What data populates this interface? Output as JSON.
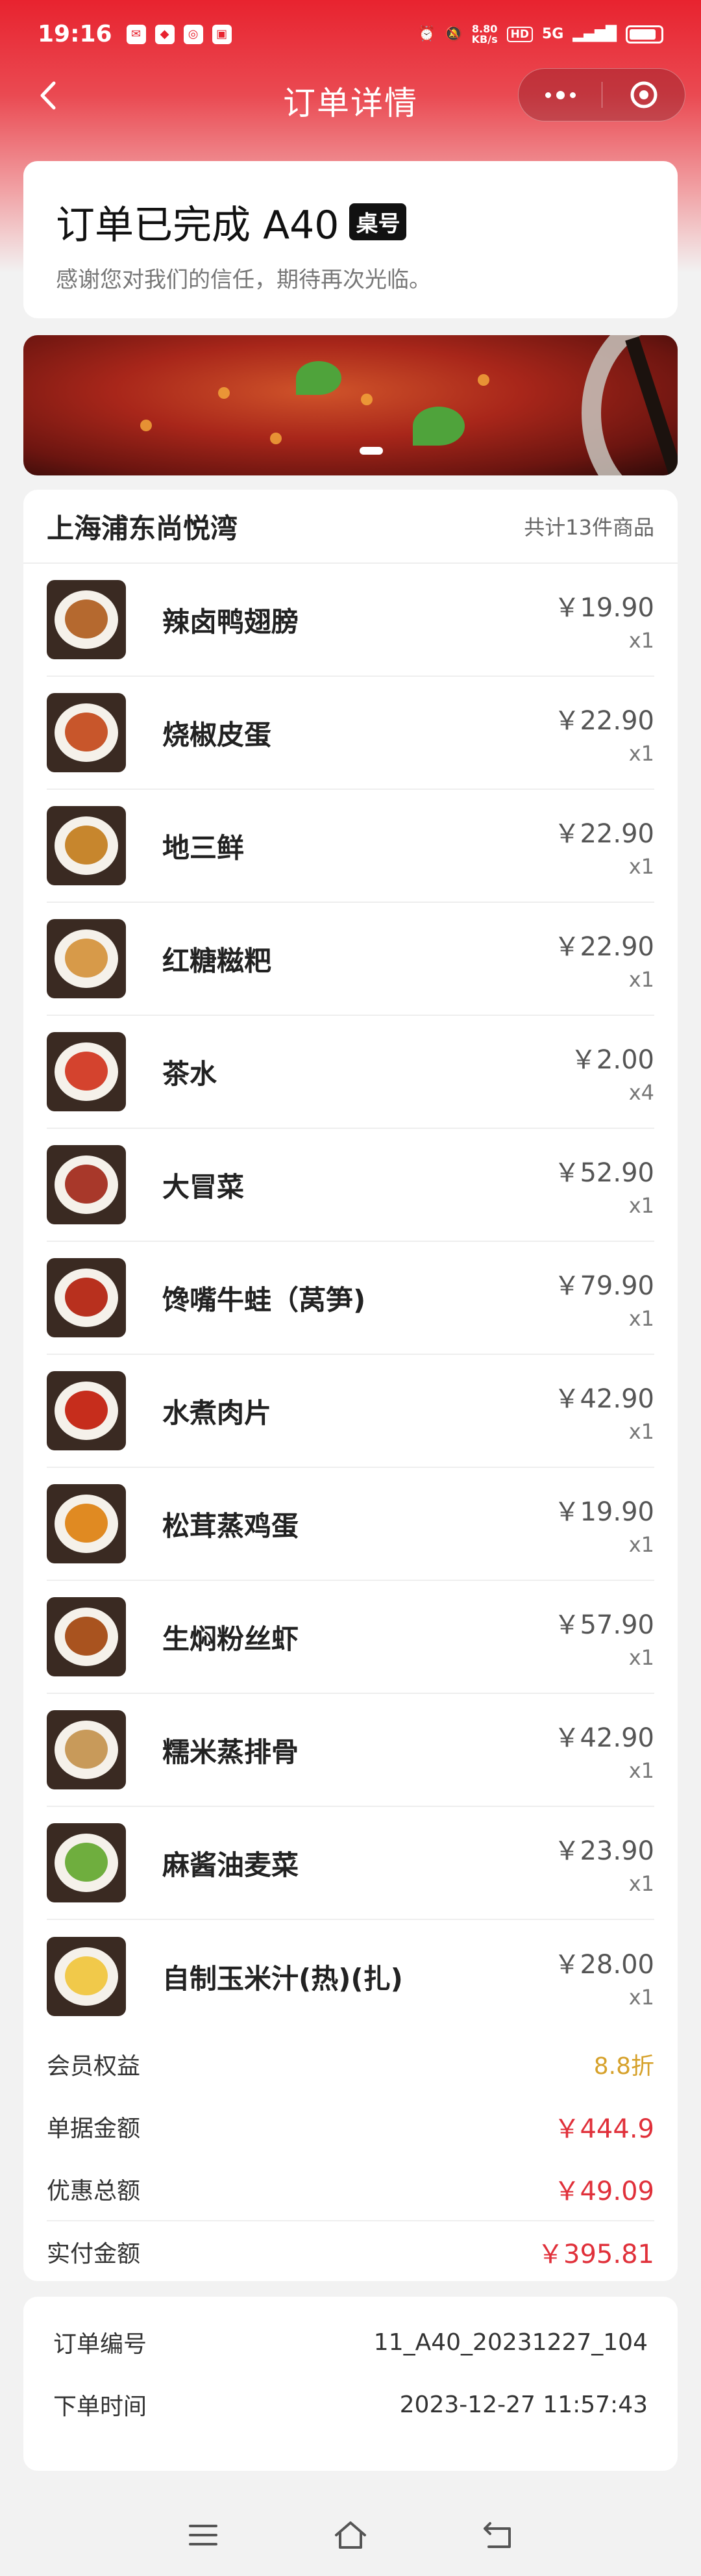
{
  "status_bar": {
    "time": "19:16",
    "speed_value": "8.80",
    "speed_unit": "KB/s",
    "hd_badge": "HD",
    "network": "5G"
  },
  "nav": {
    "title": "订单详情"
  },
  "order_status": {
    "title": "订单已完成 A40",
    "tag": "桌号",
    "subtitle": "感谢您对我们的信任，期待再次光临。"
  },
  "store": {
    "name": "上海浦东尚悦湾",
    "item_count": "共计13件商品"
  },
  "items": [
    {
      "name": "辣卤鸭翅膀",
      "price": "￥19.90",
      "qty": "x1",
      "color": "#b5692f"
    },
    {
      "name": "烧椒皮蛋",
      "price": "￥22.90",
      "qty": "x1",
      "color": "#c8562b"
    },
    {
      "name": "地三鲜",
      "price": "￥22.90",
      "qty": "x1",
      "color": "#c7862d"
    },
    {
      "name": "红糖糍粑",
      "price": "￥22.90",
      "qty": "x1",
      "color": "#d79a49"
    },
    {
      "name": "茶水",
      "price": "￥2.00",
      "qty": "x4",
      "color": "#d4432e"
    },
    {
      "name": "大冒菜",
      "price": "￥52.90",
      "qty": "x1",
      "color": "#a8382a"
    },
    {
      "name": "馋嘴牛蛙（莴笋)",
      "price": "￥79.90",
      "qty": "x1",
      "color": "#b8301e"
    },
    {
      "name": "水煮肉片",
      "price": "￥42.90",
      "qty": "x1",
      "color": "#c62d1c"
    },
    {
      "name": "松茸蒸鸡蛋",
      "price": "￥19.90",
      "qty": "x1",
      "color": "#e08a22"
    },
    {
      "name": "生焖粉丝虾",
      "price": "￥57.90",
      "qty": "x1",
      "color": "#a9531f"
    },
    {
      "name": "糯米蒸排骨",
      "price": "￥42.90",
      "qty": "x1",
      "color": "#c89a5a"
    },
    {
      "name": "麻酱油麦菜",
      "price": "￥23.90",
      "qty": "x1",
      "color": "#6fae3e"
    },
    {
      "name": "自制玉米汁(热)(扎)",
      "price": "￥28.00",
      "qty": "x1",
      "color": "#f1c94a"
    }
  ],
  "summary": {
    "member_label": "会员权益",
    "member_value": "8.8折",
    "bill_label": "单据金额",
    "bill_value": "￥444.9",
    "discount_label": "优惠总额",
    "discount_value": "￥49.09",
    "paid_label": "实付金额",
    "paid_value": "￥395.81"
  },
  "info": {
    "order_no_label": "订单编号",
    "order_no_value": "11_A40_20231227_104",
    "time_label": "下单时间",
    "time_value": "2023-12-27 11:57:43"
  }
}
